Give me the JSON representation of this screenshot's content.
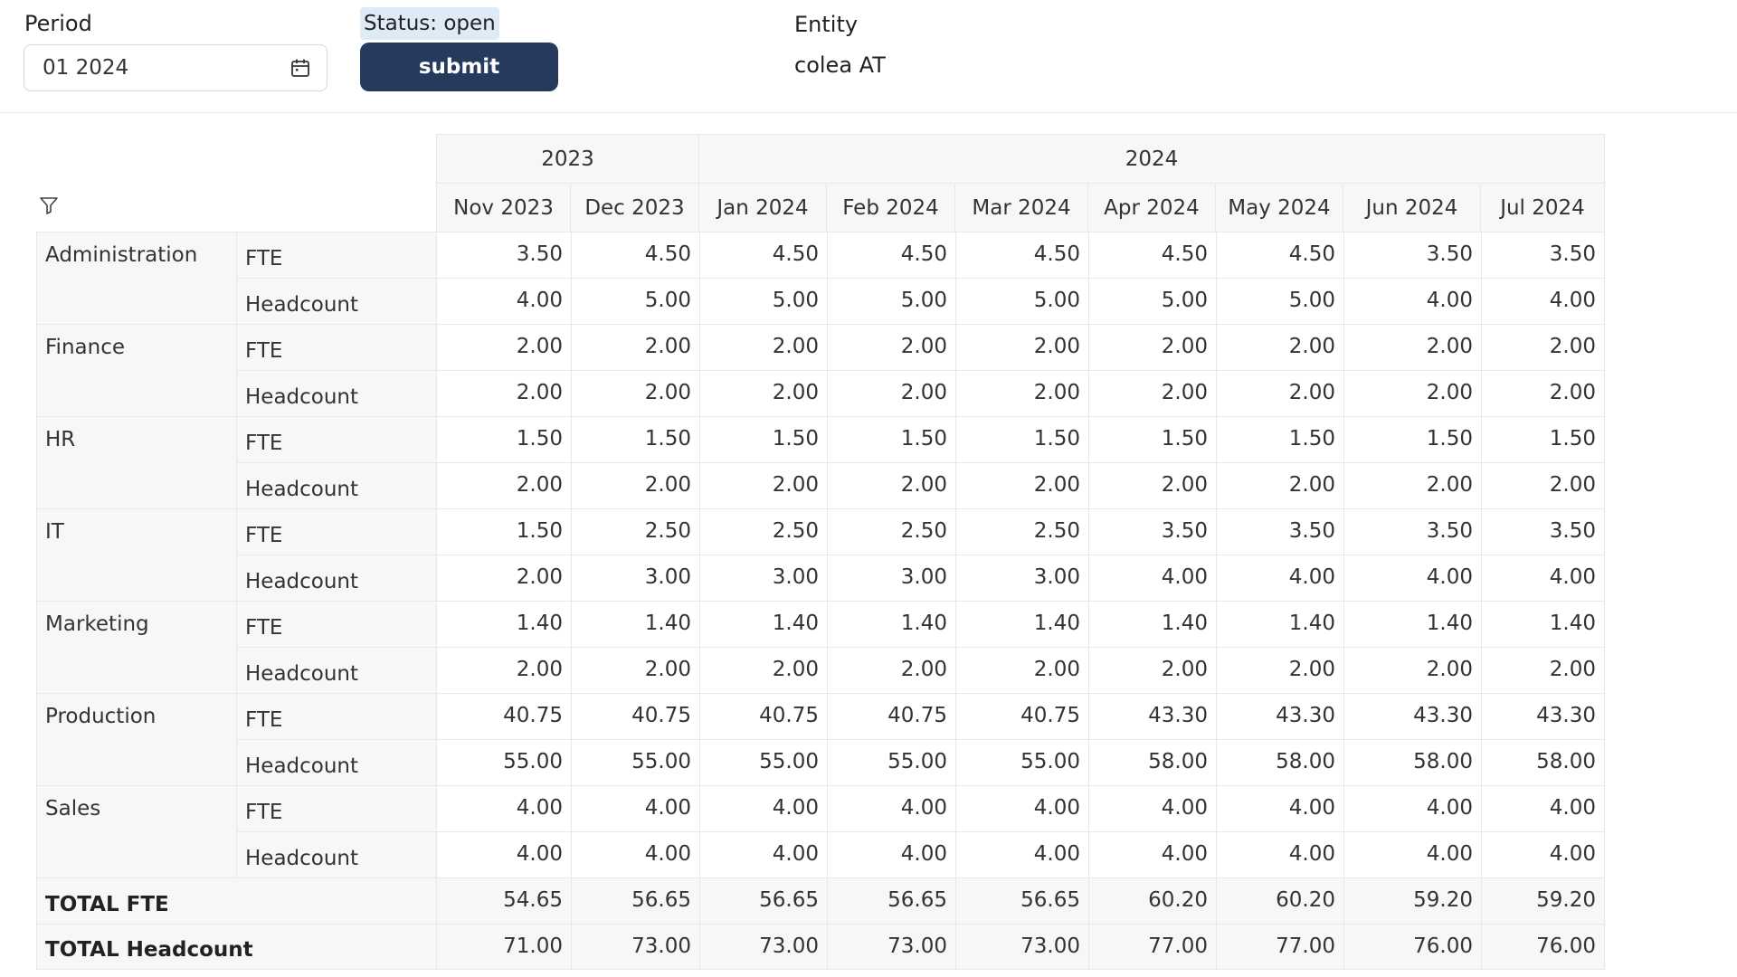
{
  "header": {
    "period_label": "Period",
    "period_value": "01 2024",
    "status_label": "Status: open",
    "submit_label": "submit",
    "entity_label": "Entity",
    "entity_value": "colea AT"
  },
  "icons": {
    "calendar": "calendar-icon",
    "filter": "filter-icon"
  },
  "colors": {
    "submit_bg": "#263a5e",
    "status_bg": "#dfeaf7",
    "header_bg": "#f7f7f7",
    "border": "#e8e8e8"
  },
  "table": {
    "years": [
      {
        "label": "2023",
        "span": 2
      },
      {
        "label": "2024",
        "span": 7
      }
    ],
    "months": [
      "Nov 2023",
      "Dec 2023",
      "Jan 2024",
      "Feb 2024",
      "Mar 2024",
      "Apr 2024",
      "May 2024",
      "Jun 2024",
      "Jul 2024"
    ],
    "departments": [
      {
        "name": "Administration",
        "rows": [
          {
            "metric": "FTE",
            "values": [
              "3.50",
              "4.50",
              "4.50",
              "4.50",
              "4.50",
              "4.50",
              "4.50",
              "3.50",
              "3.50"
            ]
          },
          {
            "metric": "Headcount",
            "values": [
              "4.00",
              "5.00",
              "5.00",
              "5.00",
              "5.00",
              "5.00",
              "5.00",
              "4.00",
              "4.00"
            ]
          }
        ]
      },
      {
        "name": "Finance",
        "rows": [
          {
            "metric": "FTE",
            "values": [
              "2.00",
              "2.00",
              "2.00",
              "2.00",
              "2.00",
              "2.00",
              "2.00",
              "2.00",
              "2.00"
            ]
          },
          {
            "metric": "Headcount",
            "values": [
              "2.00",
              "2.00",
              "2.00",
              "2.00",
              "2.00",
              "2.00",
              "2.00",
              "2.00",
              "2.00"
            ]
          }
        ]
      },
      {
        "name": "HR",
        "rows": [
          {
            "metric": "FTE",
            "values": [
              "1.50",
              "1.50",
              "1.50",
              "1.50",
              "1.50",
              "1.50",
              "1.50",
              "1.50",
              "1.50"
            ]
          },
          {
            "metric": "Headcount",
            "values": [
              "2.00",
              "2.00",
              "2.00",
              "2.00",
              "2.00",
              "2.00",
              "2.00",
              "2.00",
              "2.00"
            ]
          }
        ]
      },
      {
        "name": "IT",
        "rows": [
          {
            "metric": "FTE",
            "values": [
              "1.50",
              "2.50",
              "2.50",
              "2.50",
              "2.50",
              "3.50",
              "3.50",
              "3.50",
              "3.50"
            ]
          },
          {
            "metric": "Headcount",
            "values": [
              "2.00",
              "3.00",
              "3.00",
              "3.00",
              "3.00",
              "4.00",
              "4.00",
              "4.00",
              "4.00"
            ]
          }
        ]
      },
      {
        "name": "Marketing",
        "rows": [
          {
            "metric": "FTE",
            "values": [
              "1.40",
              "1.40",
              "1.40",
              "1.40",
              "1.40",
              "1.40",
              "1.40",
              "1.40",
              "1.40"
            ]
          },
          {
            "metric": "Headcount",
            "values": [
              "2.00",
              "2.00",
              "2.00",
              "2.00",
              "2.00",
              "2.00",
              "2.00",
              "2.00",
              "2.00"
            ]
          }
        ]
      },
      {
        "name": "Production",
        "rows": [
          {
            "metric": "FTE",
            "values": [
              "40.75",
              "40.75",
              "40.75",
              "40.75",
              "40.75",
              "43.30",
              "43.30",
              "43.30",
              "43.30"
            ]
          },
          {
            "metric": "Headcount",
            "values": [
              "55.00",
              "55.00",
              "55.00",
              "55.00",
              "55.00",
              "58.00",
              "58.00",
              "58.00",
              "58.00"
            ]
          }
        ]
      },
      {
        "name": "Sales",
        "rows": [
          {
            "metric": "FTE",
            "values": [
              "4.00",
              "4.00",
              "4.00",
              "4.00",
              "4.00",
              "4.00",
              "4.00",
              "4.00",
              "4.00"
            ]
          },
          {
            "metric": "Headcount",
            "values": [
              "4.00",
              "4.00",
              "4.00",
              "4.00",
              "4.00",
              "4.00",
              "4.00",
              "4.00",
              "4.00"
            ]
          }
        ]
      }
    ],
    "totals": [
      {
        "label": "TOTAL FTE",
        "values": [
          "54.65",
          "56.65",
          "56.65",
          "56.65",
          "56.65",
          "60.20",
          "60.20",
          "59.20",
          "59.20"
        ]
      },
      {
        "label": "TOTAL Headcount",
        "values": [
          "71.00",
          "73.00",
          "73.00",
          "73.00",
          "73.00",
          "77.00",
          "77.00",
          "76.00",
          "76.00"
        ]
      }
    ]
  }
}
